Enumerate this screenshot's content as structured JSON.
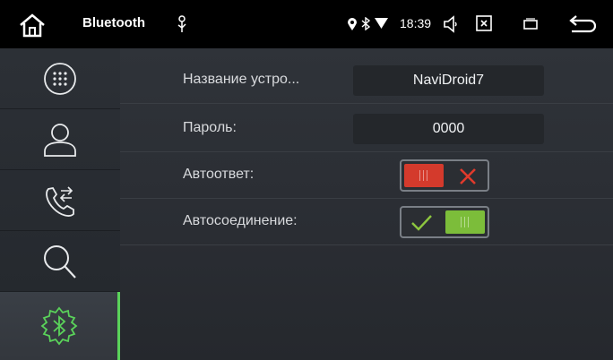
{
  "statusbar": {
    "title": "Bluetooth",
    "time": "18:39",
    "icons": [
      "home-icon",
      "usb-icon",
      "location-icon",
      "bluetooth-icon",
      "wifi-icon",
      "volume-icon",
      "screenshot-icon",
      "recent-apps-icon",
      "back-icon"
    ]
  },
  "sidebar": {
    "items": [
      {
        "name": "dialpad",
        "icon": "dialpad-icon",
        "active": false
      },
      {
        "name": "contacts",
        "icon": "person-icon",
        "active": false
      },
      {
        "name": "call-log",
        "icon": "call-transfer-icon",
        "active": false
      },
      {
        "name": "search",
        "icon": "search-icon",
        "active": false
      },
      {
        "name": "bluetooth-settings",
        "icon": "bluetooth-gear-icon",
        "active": true
      }
    ]
  },
  "settings": {
    "device_name_label": "Название устро...",
    "device_name_value": "NaviDroid7",
    "password_label": "Пароль:",
    "password_value": "0000",
    "auto_answer_label": "Автоответ:",
    "auto_answer_state": "off",
    "auto_connect_label": "Автосоединение:",
    "auto_connect_state": "on"
  },
  "colors": {
    "toggle_off": "#d43a2c",
    "toggle_on": "#7cbd3a",
    "accent_active": "#5ad25a"
  }
}
